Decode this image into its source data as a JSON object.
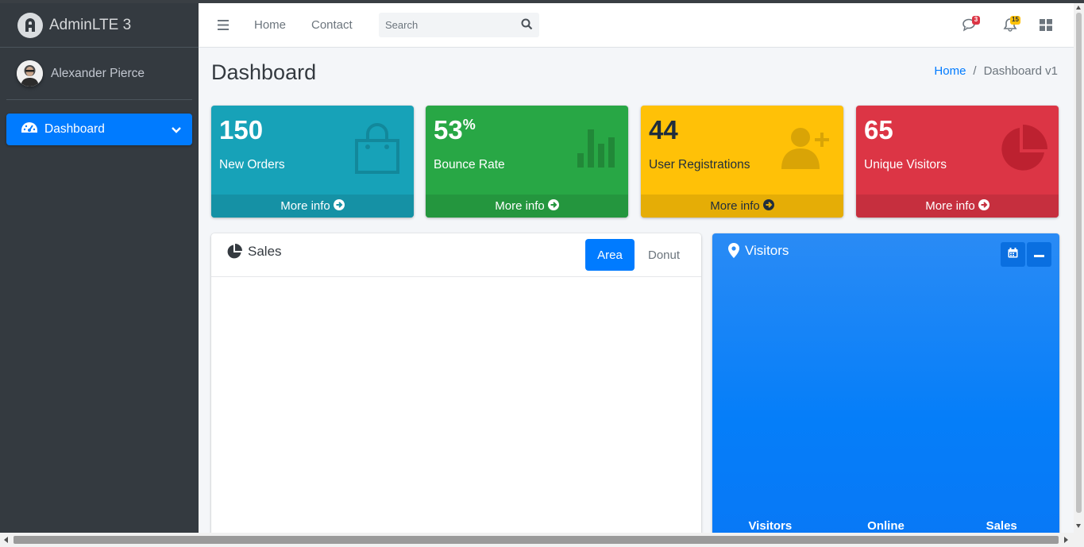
{
  "brand": {
    "name": "AdminLTE 3"
  },
  "user": {
    "name": "Alexander Pierce"
  },
  "sidebar": {
    "items": [
      {
        "label": "Dashboard",
        "icon": "tachometer-icon",
        "active": true
      }
    ]
  },
  "navbar": {
    "links": [
      "Home",
      "Contact"
    ],
    "search": {
      "placeholder": "Search",
      "value": ""
    },
    "messages_badge": "3",
    "notifications_badge": "15"
  },
  "page": {
    "title": "Dashboard",
    "breadcrumb": {
      "home": "Home",
      "separator": "/",
      "current": "Dashboard v1"
    }
  },
  "small_boxes": [
    {
      "value": "150",
      "suffix": "",
      "label": "New Orders",
      "footer": "More info",
      "color": "#17a2b8",
      "icon": "shopping-bag-icon"
    },
    {
      "value": "53",
      "suffix": "%",
      "label": "Bounce Rate",
      "footer": "More info",
      "color": "#28a745",
      "icon": "bar-chart-icon"
    },
    {
      "value": "44",
      "suffix": "",
      "label": "User Registrations",
      "footer": "More info",
      "color": "#ffc107",
      "icon": "user-plus-icon"
    },
    {
      "value": "65",
      "suffix": "",
      "label": "Unique Visitors",
      "footer": "More info",
      "color": "#dc3545",
      "icon": "pie-chart-icon"
    }
  ],
  "sales_card": {
    "title": "Sales",
    "tabs": [
      "Area",
      "Donut"
    ],
    "active_tab": "Area"
  },
  "visitors_card": {
    "title": "Visitors",
    "stats": [
      "Visitors",
      "Online",
      "Sales"
    ]
  }
}
